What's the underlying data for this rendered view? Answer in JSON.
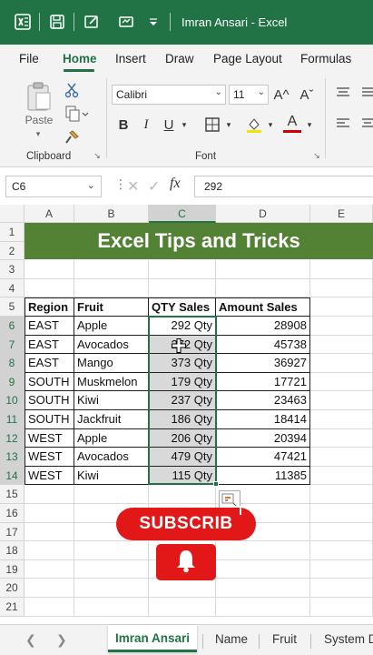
{
  "window": {
    "title": "Imran Ansari  -  Excel"
  },
  "ribbon_tabs": [
    "File",
    "Home",
    "Insert",
    "Draw",
    "Page Layout",
    "Formulas"
  ],
  "ribbon": {
    "paste_label": "Paste",
    "clipboard_label": "Clipboard",
    "font_label": "Font",
    "font_name": "Calibri",
    "font_size": "11",
    "bold": "B",
    "italic": "I",
    "underline": "U",
    "grow_font": "A^",
    "shrink_font": "Aˇ",
    "font_color": "A"
  },
  "formula_bar": {
    "name_box": "C6",
    "fx": "fx",
    "value": "292"
  },
  "columns": [
    "A",
    "B",
    "C",
    "D",
    "E"
  ],
  "rows": [
    "1",
    "2",
    "3",
    "4",
    "5",
    "6",
    "7",
    "8",
    "9",
    "10",
    "11",
    "12",
    "13",
    "14",
    "15",
    "16",
    "17",
    "18",
    "19",
    "20",
    "21"
  ],
  "banner_text": "Excel Tips and Tricks",
  "table": {
    "headers": [
      "Region",
      "Fruit",
      "QTY Sales",
      "Amount Sales"
    ],
    "rows": [
      [
        "EAST",
        "Apple",
        "292 Qty",
        "28908"
      ],
      [
        "EAST",
        "Avocados",
        "272 Qty",
        "45738"
      ],
      [
        "EAST",
        "Mango",
        "373 Qty",
        "36927"
      ],
      [
        "SOUTH",
        "Muskmelon",
        "179 Qty",
        "17721"
      ],
      [
        "SOUTH",
        "Kiwi",
        "237 Qty",
        "23463"
      ],
      [
        "SOUTH",
        "Jackfruit",
        "186 Qty",
        "18414"
      ],
      [
        "WEST",
        "Apple",
        "206 Qty",
        "20394"
      ],
      [
        "WEST",
        "Avocados",
        "479 Qty",
        "47421"
      ],
      [
        "WEST",
        "Kiwi",
        "115 Qty",
        "11385"
      ]
    ]
  },
  "overlay": {
    "subscribe": "SUBSCRIB"
  },
  "sheet_tabs": [
    "Imran Ansari",
    "Name",
    "Fruit",
    "System D"
  ],
  "colors": {
    "excel_green": "#217346",
    "banner": "#548235",
    "subscribe_red": "#e21717"
  }
}
